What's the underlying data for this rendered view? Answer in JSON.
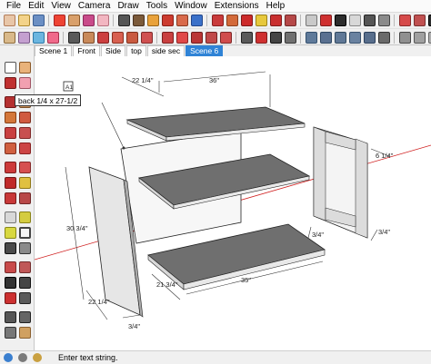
{
  "menu": [
    "File",
    "Edit",
    "View",
    "Camera",
    "Draw",
    "Tools",
    "Window",
    "Extensions",
    "Help"
  ],
  "scenes": [
    {
      "label": "Scene 1",
      "active": false
    },
    {
      "label": "Front",
      "active": false
    },
    {
      "label": "Side",
      "active": false
    },
    {
      "label": "top",
      "active": false
    },
    {
      "label": "side sec",
      "active": false
    },
    {
      "label": "Scene 6",
      "active": true
    }
  ],
  "tag_text": "back 1/4 x 27-1/2",
  "dimensions": {
    "top_width": "36\"",
    "top_depth": "22 1/4\"",
    "side_height": "30 3/4\"",
    "side_depth": "22 1/4\"",
    "side_thickness": "3/4\"",
    "bottom_depth": "21 3/4\"",
    "bottom_width": "35\"",
    "bottom_thickness": "3/4\"",
    "door_top": "6 1/4\"",
    "door_thickness": "3/4\""
  },
  "status": {
    "text": "Enter text string."
  },
  "colors": {
    "accent": "#2f83d6",
    "panel_dark": "#6d6d6d",
    "panel_light": "#e4e4e4",
    "axis_red": "#d02020"
  }
}
